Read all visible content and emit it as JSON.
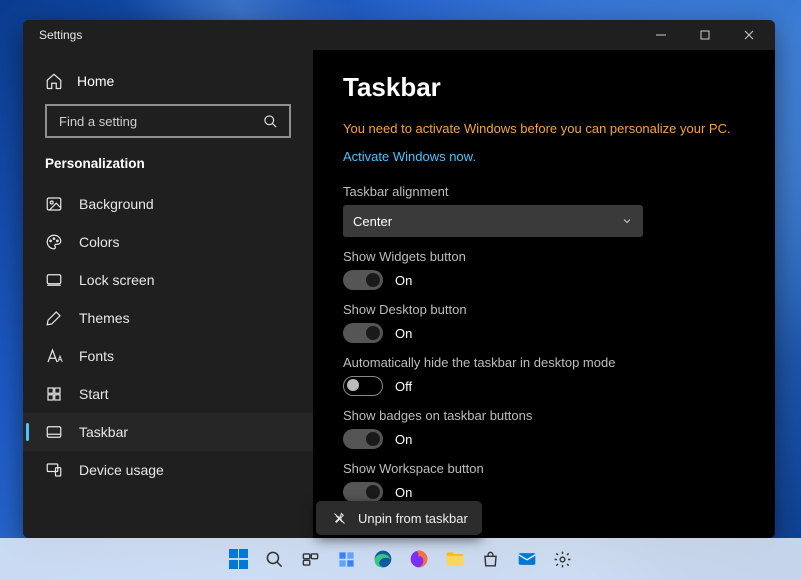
{
  "window": {
    "title": "Settings"
  },
  "sidebar": {
    "home": "Home",
    "search_placeholder": "Find a setting",
    "breadcrumb": "Personalization",
    "items": [
      {
        "label": "Background",
        "icon": "image-icon",
        "active": false
      },
      {
        "label": "Colors",
        "icon": "palette-icon",
        "active": false
      },
      {
        "label": "Lock screen",
        "icon": "lockscreen-icon",
        "active": false
      },
      {
        "label": "Themes",
        "icon": "brush-icon",
        "active": false
      },
      {
        "label": "Fonts",
        "icon": "fonts-icon",
        "active": false
      },
      {
        "label": "Start",
        "icon": "start-icon",
        "active": false
      },
      {
        "label": "Taskbar",
        "icon": "taskbar-icon",
        "active": true
      },
      {
        "label": "Device usage",
        "icon": "device-icon",
        "active": false
      }
    ]
  },
  "main": {
    "title": "Taskbar",
    "warning": "You need to activate Windows before you can personalize your PC.",
    "activate_link": "Activate Windows now.",
    "settings": [
      {
        "kind": "select",
        "label": "Taskbar alignment",
        "value": "Center"
      },
      {
        "kind": "toggle",
        "label": "Show Widgets button",
        "on": true,
        "state": "On"
      },
      {
        "kind": "toggle",
        "label": "Show Desktop button",
        "on": true,
        "state": "On"
      },
      {
        "kind": "toggle",
        "label": "Automatically hide the taskbar in desktop mode",
        "on": false,
        "state": "Off"
      },
      {
        "kind": "toggle",
        "label": "Show badges on taskbar buttons",
        "on": true,
        "state": "On"
      },
      {
        "kind": "toggle",
        "label": "Show Workspace button",
        "on": true,
        "state": "On"
      }
    ]
  },
  "context_menu": {
    "label": "Unpin from taskbar"
  },
  "taskbar_icons": [
    "windows-start-icon",
    "search-icon",
    "task-view-icon",
    "widgets-icon",
    "edge-icon",
    "firefox-icon",
    "file-explorer-icon",
    "store-icon",
    "mail-icon",
    "settings-icon"
  ]
}
